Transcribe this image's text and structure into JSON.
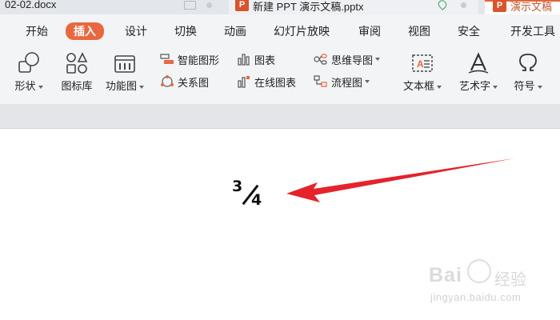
{
  "tabs": [
    {
      "label": "02-02.docx"
    },
    {
      "label": "新建 PPT 演示文稿.pptx",
      "icon": "P"
    },
    {
      "label": "演示文稿",
      "icon": "P"
    }
  ],
  "menu": {
    "items": [
      "开始",
      "插入",
      "设计",
      "切换",
      "动画",
      "幻灯片放映",
      "审阅",
      "视图",
      "安全",
      "开发工具"
    ],
    "active": "插入"
  },
  "ribbon": {
    "shape": "形状",
    "icon_library": "图标库",
    "function_chart": "功能图",
    "smart_graphic": "智能图形",
    "chart": "图表",
    "mind_map": "思维导图",
    "relation_chart": "关系图",
    "online_chart": "在线图表",
    "flowchart": "流程图",
    "textbox": "文本框",
    "wordart": "艺术字",
    "symbol": "符号"
  },
  "canvas": {
    "fraction_numerator": "3",
    "fraction_denominator": "4"
  },
  "watermark": {
    "brand": "Bai",
    "brand_cn": "经验",
    "url": "jingyan.baidu.com"
  },
  "colors": {
    "accent": "#e8693f",
    "arrow": "#e5232b",
    "ppt_icon": "#d9532b"
  }
}
